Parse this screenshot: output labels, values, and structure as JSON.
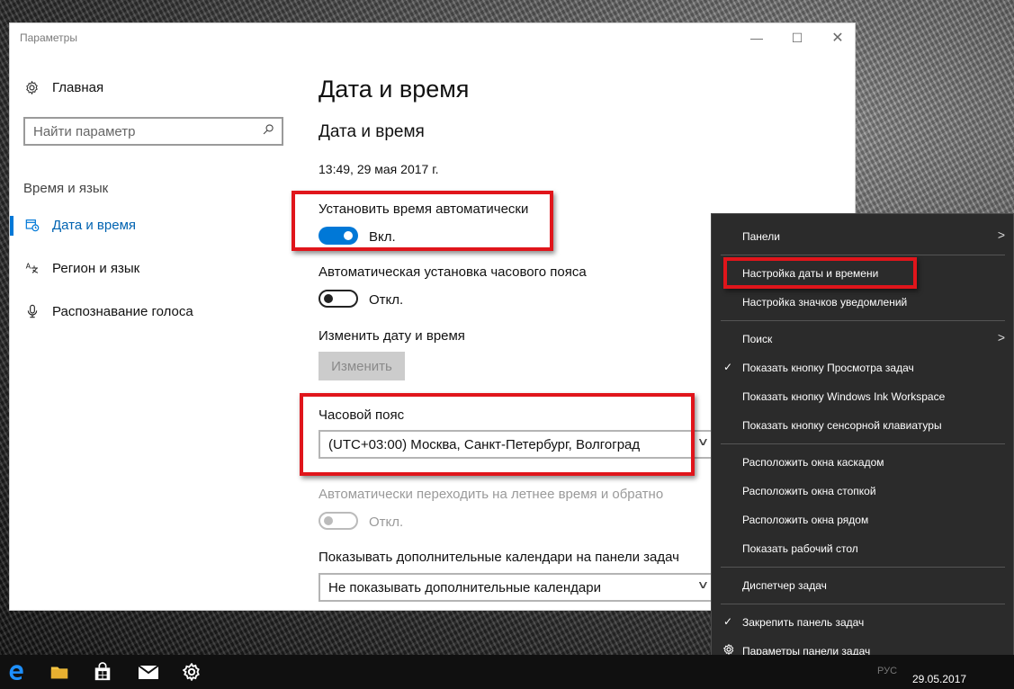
{
  "window": {
    "title": "Параметры",
    "minimize_glyph": "—",
    "maximize_glyph": "☐",
    "close_glyph": "✕"
  },
  "sidebar": {
    "home_label": "Главная",
    "home_icon": "gear-icon",
    "search_placeholder": "Найти параметр",
    "section_label": "Время и язык",
    "items": [
      {
        "label": "Дата и время",
        "icon": "calendar-clock-icon",
        "active": true
      },
      {
        "label": "Регион и язык",
        "icon": "language-icon",
        "active": false
      },
      {
        "label": "Распознавание голоса",
        "icon": "microphone-icon",
        "active": false
      }
    ]
  },
  "main": {
    "page_title": "Дата и время",
    "section_title": "Дата и время",
    "current_datetime": "13:49, 29 мая 2017 г.",
    "auto_time": {
      "label": "Установить время автоматически",
      "state": "Вкл.",
      "on": true
    },
    "auto_timezone": {
      "label": "Автоматическая установка часового пояса",
      "state": "Откл.",
      "on": false
    },
    "change_datetime": {
      "label": "Изменить дату и время",
      "button": "Изменить",
      "enabled": false
    },
    "timezone": {
      "label": "Часовой пояс",
      "value": "(UTC+03:00) Москва, Санкт-Петербург, Волгоград"
    },
    "dst": {
      "label": "Автоматически переходить на летнее время и обратно",
      "state": "Откл.",
      "enabled": false
    },
    "calendars": {
      "label": "Показывать дополнительные календари на панели задач",
      "value": "Не показывать дополнительные календари"
    }
  },
  "context_menu": {
    "items": [
      {
        "label": "Панели",
        "submenu": true,
        "checked": false
      },
      {
        "label": "Настройка даты и времени",
        "submenu": false,
        "checked": false
      },
      {
        "label": "Настройка значков уведомлений",
        "submenu": false,
        "checked": false
      },
      {
        "label": "Поиск",
        "submenu": true,
        "checked": false
      },
      {
        "label": "Показать кнопку Просмотра задач",
        "submenu": false,
        "checked": true
      },
      {
        "label": "Показать кнопку Windows Ink Workspace",
        "submenu": false,
        "checked": false
      },
      {
        "label": "Показать кнопку сенсорной клавиатуры",
        "submenu": false,
        "checked": false
      },
      {
        "label": "Расположить окна каскадом",
        "submenu": false,
        "checked": false
      },
      {
        "label": "Расположить окна стопкой",
        "submenu": false,
        "checked": false
      },
      {
        "label": "Расположить окна рядом",
        "submenu": false,
        "checked": false
      },
      {
        "label": "Показать рабочий стол",
        "submenu": false,
        "checked": false
      },
      {
        "label": "Диспетчер задач",
        "submenu": false,
        "checked": false
      },
      {
        "label": "Закрепить панель задач",
        "submenu": false,
        "checked": true
      },
      {
        "label": "Параметры панели задач",
        "submenu": false,
        "checked": false,
        "icon": "gear-icon"
      }
    ]
  },
  "taskbar": {
    "icons": [
      "edge-icon",
      "folder-icon",
      "store-icon",
      "mail-icon",
      "gear-icon"
    ],
    "tray_lang": "РУС",
    "tray_date": "29.05.2017"
  },
  "colors": {
    "accent": "#0078d7",
    "annotation_red": "#e0151b",
    "menu_bg": "#2b2b2b"
  }
}
